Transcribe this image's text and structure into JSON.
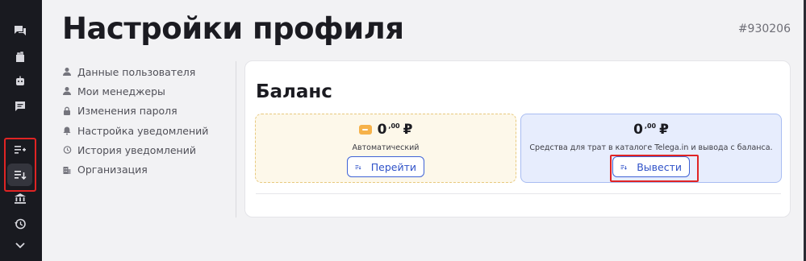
{
  "rail": {
    "items": [
      {
        "name": "chat-icon"
      },
      {
        "name": "catalog-bag-icon"
      },
      {
        "name": "bot-icon"
      },
      {
        "name": "message-icon"
      },
      {
        "name": "add-funds-icon"
      },
      {
        "name": "withdraw-list-icon"
      },
      {
        "name": "bank-icon"
      },
      {
        "name": "history-icon"
      },
      {
        "name": "chevron-down-icon"
      }
    ],
    "active_item": "withdraw-list-icon"
  },
  "header": {
    "title": "Настройки профиля",
    "profile_id": "#930206"
  },
  "settings_nav": {
    "items": [
      {
        "label": "Данные пользователя",
        "icon": "user-icon"
      },
      {
        "label": "Мои менеджеры",
        "icon": "managers-icon"
      },
      {
        "label": "Изменения пароля",
        "icon": "lock-icon"
      },
      {
        "label": "Настройка уведомлений",
        "icon": "bell-icon"
      },
      {
        "label": "История уведомлений",
        "icon": "history-icon"
      },
      {
        "label": "Организация",
        "icon": "building-icon"
      }
    ]
  },
  "balance": {
    "title": "Баланс",
    "automatic": {
      "amount_int": "0",
      "amount_frac": ",00",
      "currency": "₽",
      "description": "Автоматический",
      "button_label": "Перейти"
    },
    "wallet": {
      "amount_int": "0",
      "amount_frac": ",00",
      "currency": "₽",
      "description": "Средства для трат в каталоге Telega.in и вывода с баланса.",
      "button_label": "Вывести"
    }
  },
  "colors": {
    "rail_bg": "#191a20",
    "accent": "#3f63d6",
    "highlight": "#e02424",
    "auto_panel_bg": "#fdf8ea",
    "wallet_panel_bg": "#e7edfd"
  }
}
